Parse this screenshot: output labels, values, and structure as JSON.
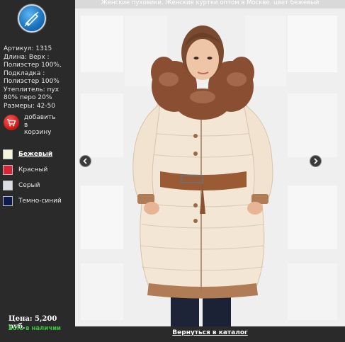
{
  "logo": {
    "icon": "pencil-logo-icon"
  },
  "product": {
    "title": "Женские пуховики. Женские куртки оптом в Москве. цвет бежевый",
    "specs": [
      "Артикул: 1315",
      "Длина: Верх :",
      "Полиэстер 100%,",
      "Подкладка :",
      "Полиэстер 100%",
      "Утеплитель: пух",
      "80% перо 20%",
      "Размеры: 42-50"
    ],
    "add_to_cart": [
      "добавить",
      "в",
      "корзину"
    ],
    "price": "Цена: 5,200 руб.",
    "stock": "Есть в наличии"
  },
  "colors": [
    {
      "label": "Бежевый",
      "swatch": "#f6f2dc",
      "active": true
    },
    {
      "label": "Красный",
      "swatch": "#d9253a",
      "active": false
    },
    {
      "label": "Серый",
      "swatch": "#dcdce4",
      "active": false
    },
    {
      "label": "Темно-синий",
      "swatch": "#0d1a4d",
      "active": false
    }
  ],
  "navigation": {
    "prev_icon": "chevron-left-icon",
    "next_icon": "chevron-right-icon",
    "back_link": "Вернуться в каталог"
  },
  "palette": {
    "sidebar_bg": "#2a2a2a",
    "cart_red": "#d0181b",
    "stock_green": "#3cc13c",
    "coat_cream": "#f3e6d4",
    "fur_brown": "#8a4e33"
  }
}
